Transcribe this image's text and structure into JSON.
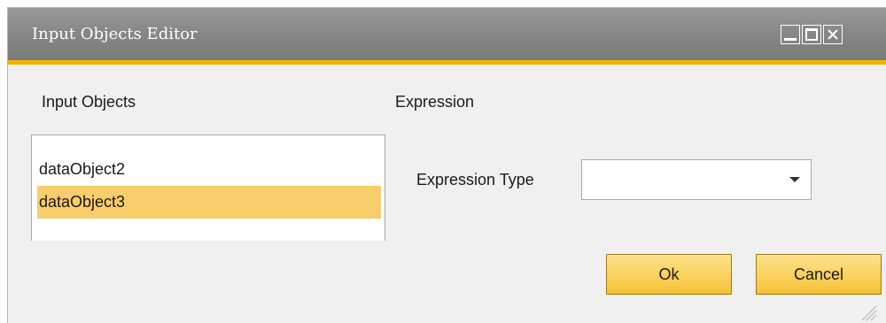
{
  "window": {
    "title": "Input Objects Editor"
  },
  "input_objects": {
    "label": "Input Objects",
    "items": [
      "dataObject2",
      "dataObject3"
    ],
    "selected_index": 1
  },
  "expression": {
    "label": "Expression",
    "type_label": "Expression Type",
    "type_value": ""
  },
  "buttons": {
    "ok": "Ok",
    "cancel": "Cancel"
  },
  "colors": {
    "title_accent": "#f5b400",
    "selection": "#f8cd6b",
    "button_fill": "#f9cf58"
  },
  "icons": {
    "minimize": "minimize-icon",
    "maximize": "maximize-icon",
    "close": "close-icon",
    "dropdown": "chevron-down-icon",
    "resize": "resize-grip-icon"
  }
}
